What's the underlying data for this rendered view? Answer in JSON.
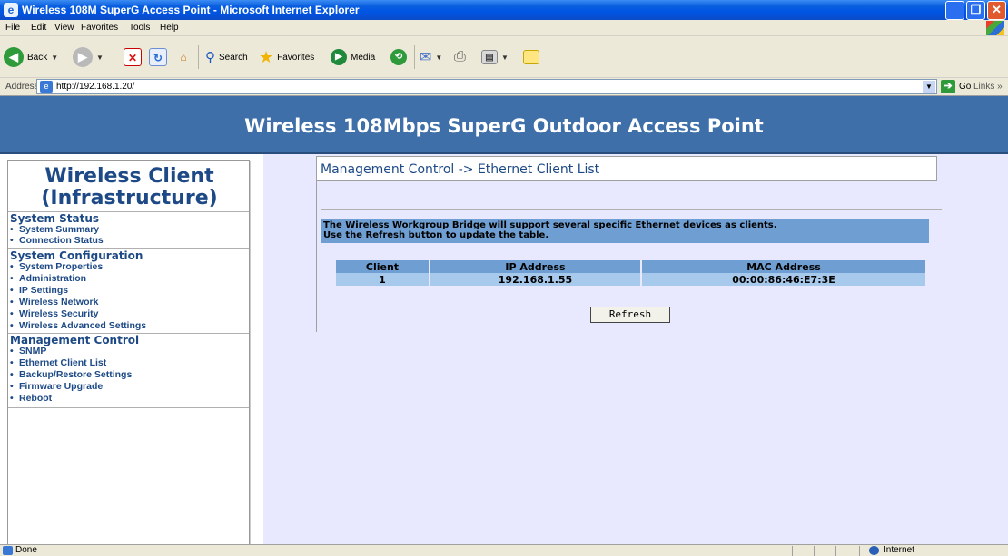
{
  "window": {
    "title": "Wireless 108M SuperG Access Point - Microsoft Internet Explorer",
    "controls": {
      "minimize": "_",
      "maximize": "❐",
      "close": "✕"
    }
  },
  "menu": [
    "File",
    "Edit",
    "View",
    "Favorites",
    "Tools",
    "Help"
  ],
  "toolbar": {
    "back": "Back",
    "search": "Search",
    "favorites": "Favorites",
    "media": "Media"
  },
  "address": {
    "label": "Address",
    "url": "http://192.168.1.20/",
    "go": "Go",
    "links": "Links"
  },
  "banner": {
    "title": "Wireless 108Mbps SuperG Outdoor Access Point"
  },
  "sidebar": {
    "heading_line1": "Wireless Client",
    "heading_line2": "(Infrastructure)",
    "sections": [
      {
        "title": "System Status",
        "items": [
          "System Summary",
          "Connection Status"
        ]
      },
      {
        "title": "System Configuration",
        "items": [
          "System Properties",
          "Administration",
          "IP Settings",
          "Wireless Network",
          "Wireless Security",
          "Wireless Advanced Settings"
        ]
      },
      {
        "title": "Management Control",
        "items": [
          "SNMP",
          "Ethernet Client List",
          "Backup/Restore Settings",
          "Firmware Upgrade",
          "Reboot"
        ]
      }
    ]
  },
  "main": {
    "breadcrumb": "Management Control -> Ethernet Client List",
    "info_line1": "The Wireless Workgroup Bridge will support several specific Ethernet devices as clients.",
    "info_line2": "Use the Refresh button to update the table.",
    "table": {
      "headers": [
        "Client",
        "IP Address",
        "MAC Address"
      ],
      "rows": [
        [
          "1",
          "192.168.1.55",
          "00:00:86:46:E7:3E"
        ]
      ]
    },
    "refresh_label": "Refresh"
  },
  "status": {
    "text": "Done",
    "zone": "Internet"
  },
  "colors": {
    "banner": "#3e6fa8",
    "link": "#1d4a86",
    "content_bg": "#e8e8ff",
    "header_cell": "#6f9fd2",
    "data_cell": "#a7c9ec"
  }
}
